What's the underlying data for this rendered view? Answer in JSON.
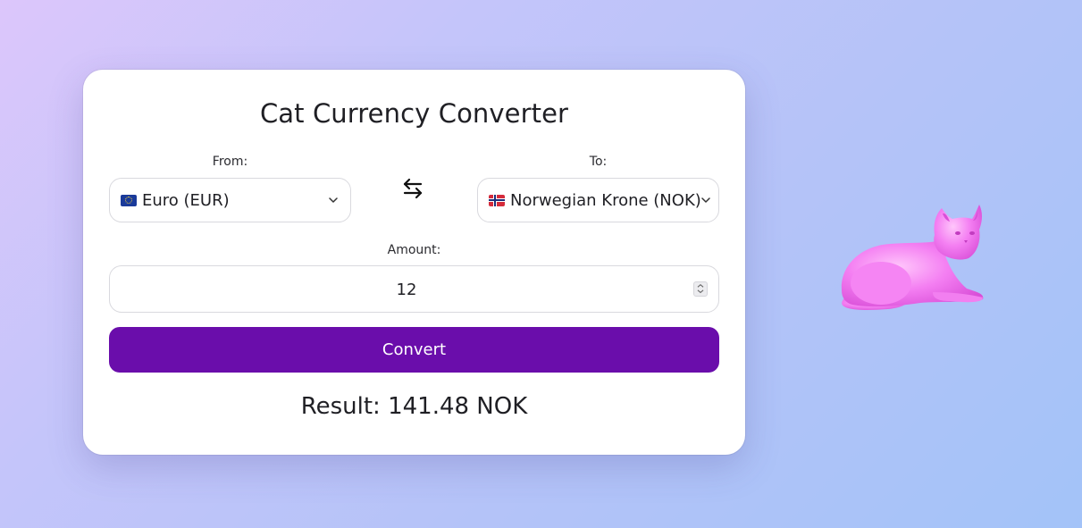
{
  "app": {
    "title": "Cat Currency Converter"
  },
  "from": {
    "label": "From:",
    "selected": "Euro (EUR)",
    "flag": "eu-flag-icon"
  },
  "to": {
    "label": "To:",
    "selected": "Norwegian Krone (NOK)",
    "flag": "norway-flag-icon"
  },
  "swap": {
    "icon": "swap-arrows-icon"
  },
  "amount": {
    "label": "Amount:",
    "value": "12"
  },
  "convert": {
    "label": "Convert",
    "color": "#6a0dab"
  },
  "result": {
    "text": "Result: 141.48 NOK"
  },
  "decoration": {
    "icon": "pink-cat-figure",
    "color": "#f27ff0"
  }
}
